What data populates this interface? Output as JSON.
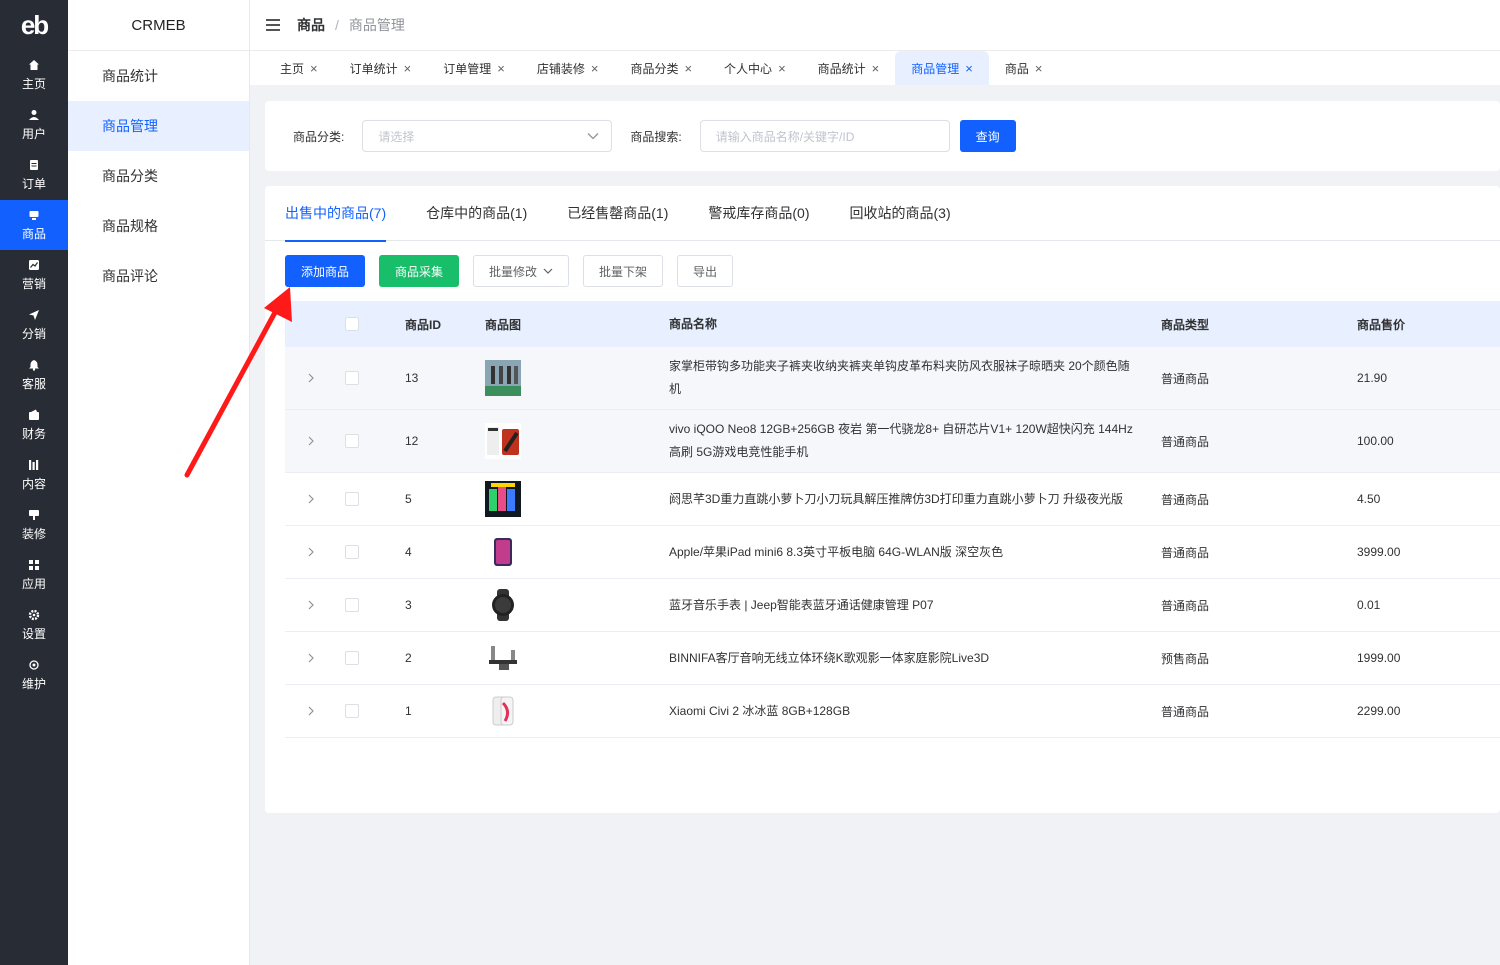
{
  "brand": {
    "logo": "eb",
    "name": "CRMEB"
  },
  "rail": [
    {
      "label": "主页",
      "icon": "home-icon"
    },
    {
      "label": "用户",
      "icon": "user-icon"
    },
    {
      "label": "订单",
      "icon": "order-icon"
    },
    {
      "label": "商品",
      "icon": "product-icon",
      "active": true
    },
    {
      "label": "营销",
      "icon": "marketing-icon"
    },
    {
      "label": "分销",
      "icon": "send-icon"
    },
    {
      "label": "客服",
      "icon": "bell-icon"
    },
    {
      "label": "财务",
      "icon": "wallet-icon"
    },
    {
      "label": "内容",
      "icon": "content-icon"
    },
    {
      "label": "装修",
      "icon": "decorate-icon"
    },
    {
      "label": "应用",
      "icon": "apps-icon"
    },
    {
      "label": "设置",
      "icon": "gear-icon"
    },
    {
      "label": "维护",
      "icon": "maintain-icon"
    }
  ],
  "submenu": [
    "商品统计",
    "商品管理",
    "商品分类",
    "商品规格",
    "商品评论"
  ],
  "breadcrumb": {
    "first": "商品",
    "sep": "/",
    "second": "商品管理"
  },
  "tabs": [
    {
      "label": "主页"
    },
    {
      "label": "订单统计"
    },
    {
      "label": "订单管理"
    },
    {
      "label": "店铺装修"
    },
    {
      "label": "商品分类"
    },
    {
      "label": "个人中心"
    },
    {
      "label": "商品统计"
    },
    {
      "label": "商品管理",
      "active": true
    },
    {
      "label": "商品"
    }
  ],
  "tab_close": "×",
  "filter": {
    "category_label": "商品分类:",
    "category_placeholder": "请选择",
    "search_label": "商品搜索:",
    "search_placeholder": "请输入商品名称/关键字/ID",
    "query_button": "查询"
  },
  "product_tabs": [
    "出售中的商品(7)",
    "仓库中的商品(1)",
    "已经售罄商品(1)",
    "警戒库存商品(0)",
    "回收站的商品(3)"
  ],
  "actions": {
    "add": "添加商品",
    "collect": "商品采集",
    "batch_edit": "批量修改",
    "batch_off": "批量下架",
    "export": "导出"
  },
  "table": {
    "headers": {
      "id": "商品ID",
      "image": "商品图",
      "name": "商品名称",
      "type": "商品类型",
      "price": "商品售价"
    },
    "rows": [
      {
        "id": "13",
        "name": "家掌柜带钩多功能夹子裤夹收纳夹裤夹单钩皮革布料夹防风衣服袜子晾晒夹 20个颜色随机",
        "type": "普通商品",
        "price": "21.90"
      },
      {
        "id": "12",
        "name": "vivo iQOO Neo8 12GB+256GB 夜岩 第一代骁龙8+ 自研芯片V1+ 120W超快闪充 144Hz高刷 5G游戏电竞性能手机",
        "type": "普通商品",
        "price": "100.00"
      },
      {
        "id": "5",
        "name": "阏思芊3D重力直跳小萝卜刀小刀玩具解压推牌仿3D打印重力直跳小萝卜刀 升级夜光版",
        "type": "普通商品",
        "price": "4.50"
      },
      {
        "id": "4",
        "name": "Apple/苹果iPad mini6 8.3英寸平板电脑 64G-WLAN版 深空灰色",
        "type": "普通商品",
        "price": "3999.00"
      },
      {
        "id": "3",
        "name": "蓝牙音乐手表 | Jeep智能表蓝牙通话健康管理 P07",
        "type": "普通商品",
        "price": "0.01"
      },
      {
        "id": "2",
        "name": "BINNIFA客厅音响无线立体环绕K歌观影一体家庭影院Live3D",
        "type": "预售商品",
        "price": "1999.00"
      },
      {
        "id": "1",
        "name": "Xiaomi Civi 2 冰冰蓝 8GB+128GB",
        "type": "普通商品",
        "price": "2299.00"
      }
    ]
  },
  "colors": {
    "primary": "#1261ff",
    "success": "#19be6b",
    "rail": "#282c34",
    "arrow": "#ff1a1a"
  }
}
